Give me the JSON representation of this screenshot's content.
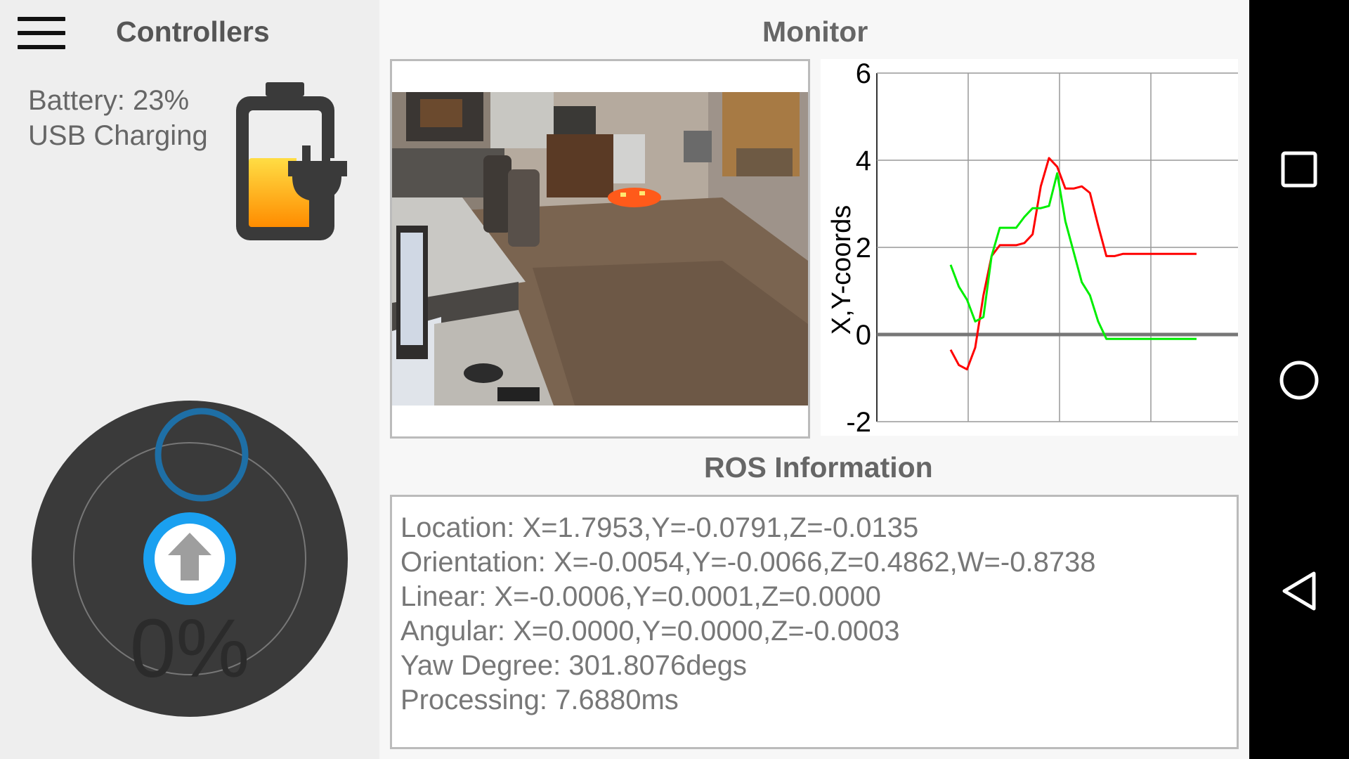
{
  "header": {
    "controllers_title": "Controllers",
    "monitor_title": "Monitor"
  },
  "battery": {
    "label": "Battery: 23%",
    "charging_label": "USB Charging",
    "level": 0.23
  },
  "joystick": {
    "percent_label": "0%"
  },
  "chart_data": {
    "type": "line",
    "ylabel": "X,Y-coords",
    "ylim": [
      -2,
      6
    ],
    "yticks": [
      "6",
      "4",
      "2",
      "0",
      "-2"
    ],
    "series": [
      {
        "color": "#ff0000",
        "values": [
          -0.35,
          -0.7,
          -0.8,
          -0.3,
          0.9,
          1.8,
          2.05,
          2.05,
          2.05,
          2.1,
          2.3,
          3.4,
          4.05,
          3.85,
          3.35,
          3.35,
          3.4,
          3.25,
          2.5,
          1.8,
          1.8,
          1.85,
          1.85,
          1.85,
          1.85,
          1.85,
          1.85,
          1.85,
          1.85,
          1.85,
          1.85
        ]
      },
      {
        "color": "#00ee00",
        "values": [
          1.6,
          1.1,
          0.8,
          0.3,
          0.4,
          1.8,
          2.45,
          2.45,
          2.45,
          2.7,
          2.9,
          2.9,
          2.95,
          3.7,
          2.6,
          1.9,
          1.2,
          0.9,
          0.3,
          -0.1,
          -0.1,
          -0.1,
          -0.1,
          -0.1,
          -0.1,
          -0.1,
          -0.1,
          -0.1,
          -0.1,
          -0.1,
          -0.1
        ]
      }
    ],
    "colors": {
      "grid": "#999999",
      "axis": "#333333",
      "zero_line": "#777777"
    }
  },
  "ros": {
    "title": "ROS Information",
    "lines": [
      "Location: X=1.7953,Y=-0.0791,Z=-0.0135",
      "Orientation: X=-0.0054,Y=-0.0066,Z=0.4862,W=-0.8738",
      "Linear: X=-0.0006,Y=0.0001,Z=0.0000",
      "Angular: X=0.0000,Y=0.0000,Z=-0.0003",
      "Yaw Degree: 301.8076degs",
      "Processing: 7.6880ms"
    ]
  },
  "icons": {
    "menu": "hamburger-menu-icon",
    "battery": "battery-charging-icon",
    "joystick_thumb": "arrow-up-icon",
    "nav_recents": "square-icon",
    "nav_home": "circle-icon",
    "nav_back": "triangle-back-icon"
  },
  "colors": {
    "accent_blue": "#1aa0f0",
    "battery_orange": "#ff9800",
    "battery_yellow": "#ffcc33",
    "joystick_bg": "#3a3a3a"
  }
}
